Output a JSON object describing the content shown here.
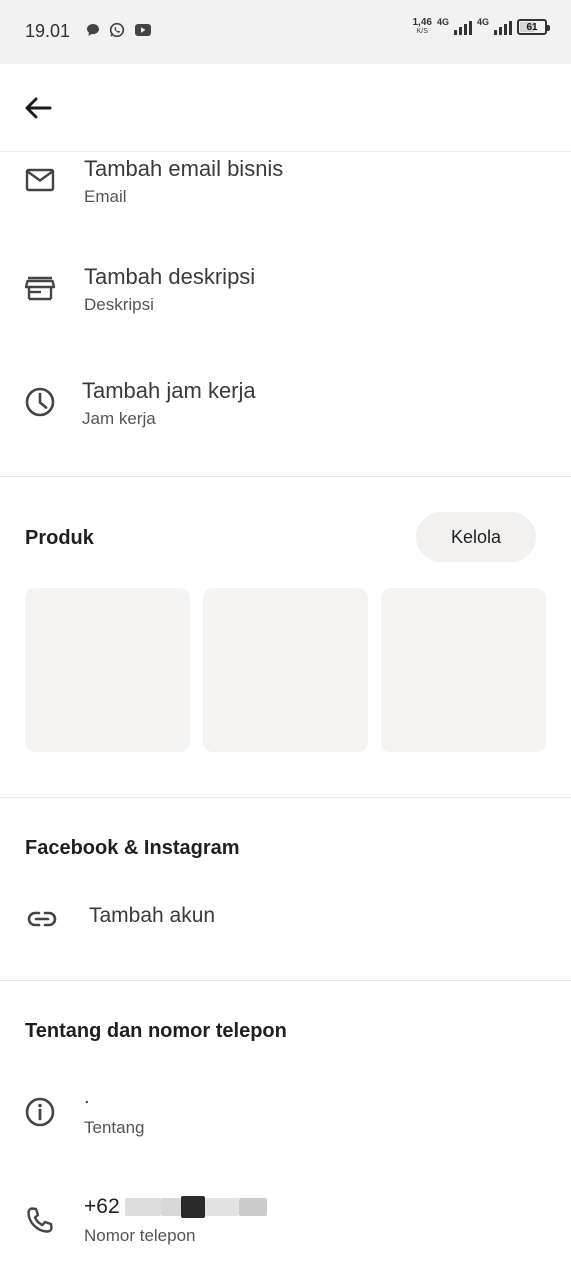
{
  "status_bar": {
    "time": "19.01",
    "speed_value": "1,46",
    "speed_unit": "K/S",
    "network_1": "4G",
    "network_2": "4G",
    "battery": "61"
  },
  "rows": {
    "email": {
      "title": "Tambah email bisnis",
      "subtitle": "Email"
    },
    "description": {
      "title": "Tambah deskripsi",
      "subtitle": "Deskripsi"
    },
    "hours": {
      "title": "Tambah jam kerja",
      "subtitle": "Jam kerja"
    }
  },
  "products": {
    "title": "Produk",
    "manage_label": "Kelola",
    "count": 3
  },
  "social": {
    "title": "Facebook & Instagram",
    "add_account": "Tambah akun"
  },
  "about": {
    "title": "Tentang dan nomor telepon",
    "about_value": ".",
    "about_label": "Tentang",
    "phone_value": "+62",
    "phone_label": "Nomor telepon"
  },
  "colors": {
    "card_bg": "#f4f3f1",
    "button_bg": "#f2f1ef",
    "status_bg": "#f2f2f2",
    "divider": "#e6e6e6"
  }
}
